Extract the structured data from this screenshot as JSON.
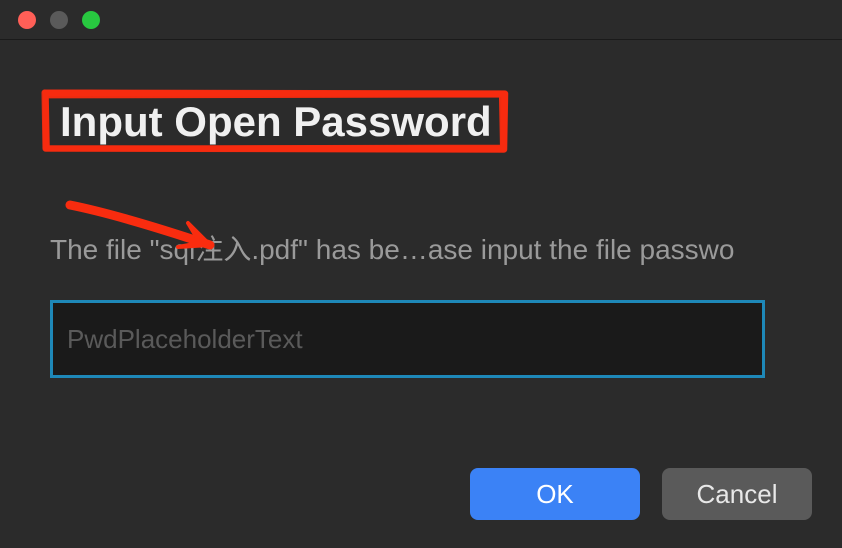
{
  "dialog": {
    "title": "Input Open Password",
    "message": "The file \"sql注入.pdf\" has be…ase input the file passwo",
    "password_placeholder": "PwdPlaceholderText",
    "ok_label": "OK",
    "cancel_label": "Cancel"
  },
  "annotations": {
    "highlight_color": "#f92c0f"
  }
}
